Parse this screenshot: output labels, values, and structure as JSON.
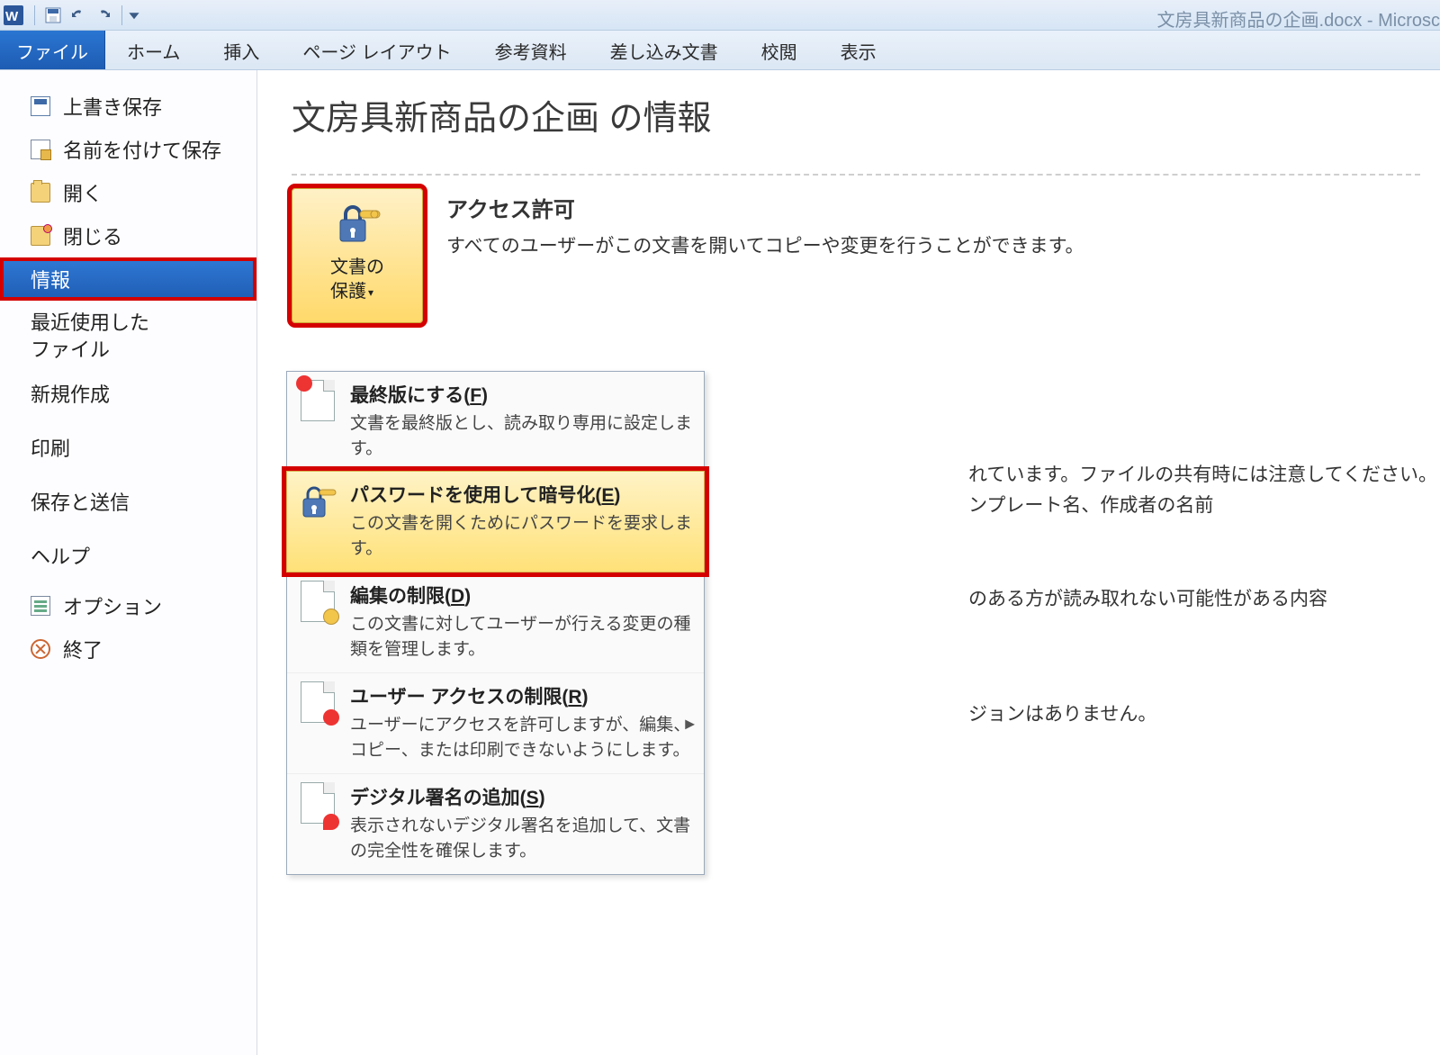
{
  "title_suffix": "文房具新商品の企画.docx - Microsc",
  "ribbon": {
    "file": "ファイル",
    "tabs": [
      "ホーム",
      "挿入",
      "ページ レイアウト",
      "参考資料",
      "差し込み文書",
      "校閲",
      "表示"
    ]
  },
  "nav": {
    "save": "上書き保存",
    "save_as": "名前を付けて保存",
    "open": "開く",
    "close": "閉じる",
    "info": "情報",
    "recent_line1": "最近使用した",
    "recent_line2": "ファイル",
    "new": "新規作成",
    "print": "印刷",
    "save_send": "保存と送信",
    "help": "ヘルプ",
    "options": "オプション",
    "exit": "終了"
  },
  "content": {
    "heading": "文房具新商品の企画 の情報",
    "permissions_title": "アクセス許可",
    "permissions_body": "すべてのユーザーがこの文書を開いてコピーや変更を行うことができます。",
    "protect_line1": "文書の",
    "protect_line2": "保護"
  },
  "menu": {
    "final_title_pre": "最終版にする(",
    "final_title_key": "F",
    "final_title_post": ")",
    "final_desc": "文書を最終版とし、読み取り専用に設定します。",
    "encrypt_title_pre": "パスワードを使用して暗号化(",
    "encrypt_title_key": "E",
    "encrypt_title_post": ")",
    "encrypt_desc": "この文書を開くためにパスワードを要求します。",
    "restrict_title_pre": "編集の制限(",
    "restrict_title_key": "D",
    "restrict_title_post": ")",
    "restrict_desc": "この文書に対してユーザーが行える変更の種類を管理します。",
    "access_title_pre": "ユーザー アクセスの制限(",
    "access_title_key": "R",
    "access_title_post": ")",
    "access_desc": "ユーザーにアクセスを許可しますが、編集、コピー、または印刷できないようにします。",
    "sig_title_pre": "デジタル署名の追加(",
    "sig_title_key": "S",
    "sig_title_post": ")",
    "sig_desc": "表示されないデジタル署名を追加して、文書の完全性を確保します。"
  },
  "bg": {
    "share_caution": "れています。ファイルの共有時には注意してください。",
    "template_author": "ンプレート名、作成者の名前",
    "disability": "のある方が読み取れない可能性がある内容",
    "no_version": "ジョンはありません。"
  }
}
